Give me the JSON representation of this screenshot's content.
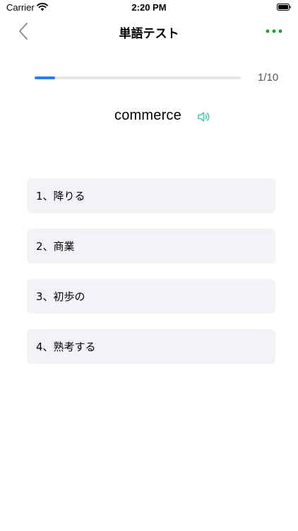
{
  "status": {
    "carrier": "Carrier",
    "time": "2:20 PM"
  },
  "nav": {
    "title": "単語テスト",
    "back_icon": "chevron-left-icon",
    "more_icon": "more-dots-icon"
  },
  "progress": {
    "current": 1,
    "total": 10,
    "label": "1/10",
    "fraction": 0.1
  },
  "question": {
    "word": "commerce",
    "speaker_icon": "speaker-icon"
  },
  "options": [
    {
      "label": "1、降りる"
    },
    {
      "label": "2、商業"
    },
    {
      "label": "3、初歩の"
    },
    {
      "label": "4、熟考する"
    }
  ],
  "colors": {
    "accent_blue": "#2d7cf6",
    "more_green": "#1f9d2e",
    "speaker_teal": "#4cc4b6",
    "option_bg": "#f2f2f7"
  }
}
